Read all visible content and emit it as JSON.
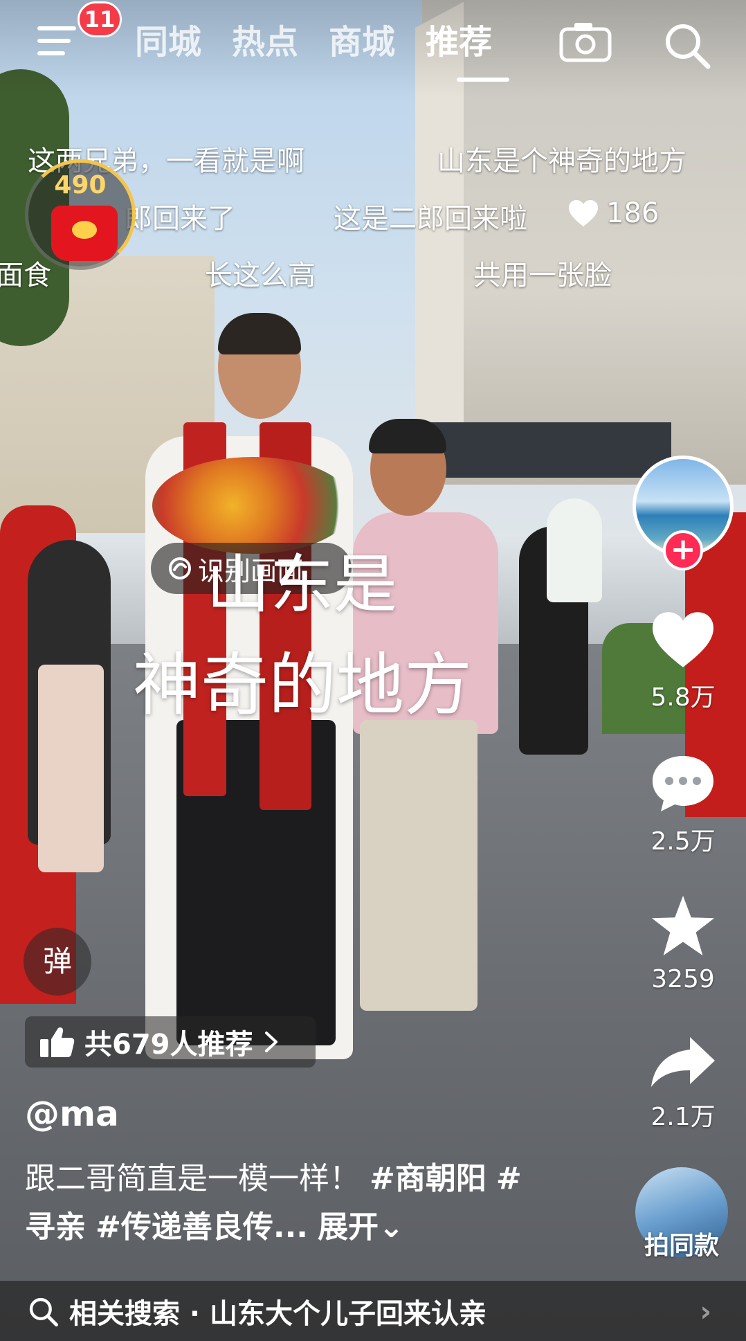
{
  "header": {
    "menu_badge": "11",
    "tabs": [
      {
        "label": "同城",
        "active": false
      },
      {
        "label": "热点",
        "active": false
      },
      {
        "label": "商城",
        "active": false
      },
      {
        "label": "推荐",
        "active": true
      }
    ],
    "icons": [
      "menu-icon",
      "camera-icon",
      "search-icon"
    ]
  },
  "danmaku": [
    "这两兄弟，一看就是啊",
    "山东是个神奇的地方",
    "郎回来了",
    "这是二郎回来啦",
    "面食",
    "长这么高",
    "共用一张脸"
  ],
  "danmaku_likes": "186",
  "red_packet": {
    "count": "490"
  },
  "recognize_label": "识别画面",
  "caption": {
    "line1": "山东是",
    "line2": "神奇的地方"
  },
  "sidebar": {
    "likes": "5.8万",
    "comments": "2.5万",
    "favorites": "3259",
    "shares": "2.1万"
  },
  "danmu_toggle": "弹",
  "recommend": {
    "label": "共679人推荐"
  },
  "post": {
    "author": "@ma",
    "desc_text": "跟二哥简直是一模一样！",
    "tags": [
      "#商朝阳",
      "#寻亲",
      "#传递善良传..."
    ],
    "expand_label": "展开"
  },
  "same_style_label": "拍同款",
  "related_search": "相关搜索 · 山东大个儿子回来认亲",
  "colors": {
    "accent": "#fe2c55",
    "badge": "#f53b48",
    "coin": "#f5c54a"
  }
}
